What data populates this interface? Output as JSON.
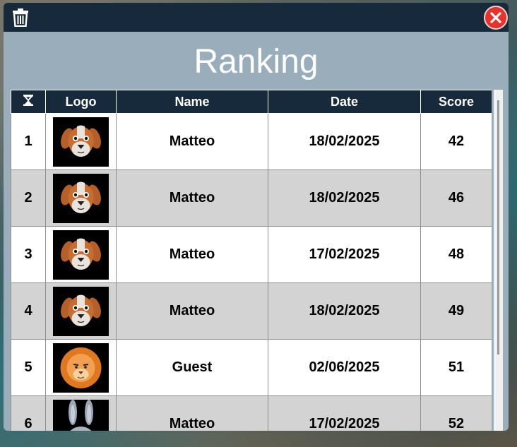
{
  "window": {
    "title": "Ranking",
    "accent_color": "#172a3b",
    "panel_color": "#99adbb",
    "close_color": "#e8322c"
  },
  "toolbar": {
    "trash_icon": "trash-icon",
    "close_icon": "close-icon"
  },
  "table": {
    "headers": {
      "rank_icon": "hourglass-icon",
      "logo": "Logo",
      "name": "Name",
      "date": "Date",
      "score": "Score"
    },
    "rows": [
      {
        "rank": "1",
        "logo": "dog-avatar",
        "name": "Matteo",
        "date": "18/02/2025",
        "score": "42"
      },
      {
        "rank": "2",
        "logo": "dog-avatar",
        "name": "Matteo",
        "date": "18/02/2025",
        "score": "46"
      },
      {
        "rank": "3",
        "logo": "dog-avatar",
        "name": "Matteo",
        "date": "17/02/2025",
        "score": "48"
      },
      {
        "rank": "4",
        "logo": "dog-avatar",
        "name": "Matteo",
        "date": "18/02/2025",
        "score": "49"
      },
      {
        "rank": "5",
        "logo": "lion-avatar",
        "name": "Guest",
        "date": "02/06/2025",
        "score": "51"
      },
      {
        "rank": "6",
        "logo": "rabbit-avatar",
        "name": "Matteo",
        "date": "17/02/2025",
        "score": "52"
      }
    ]
  }
}
